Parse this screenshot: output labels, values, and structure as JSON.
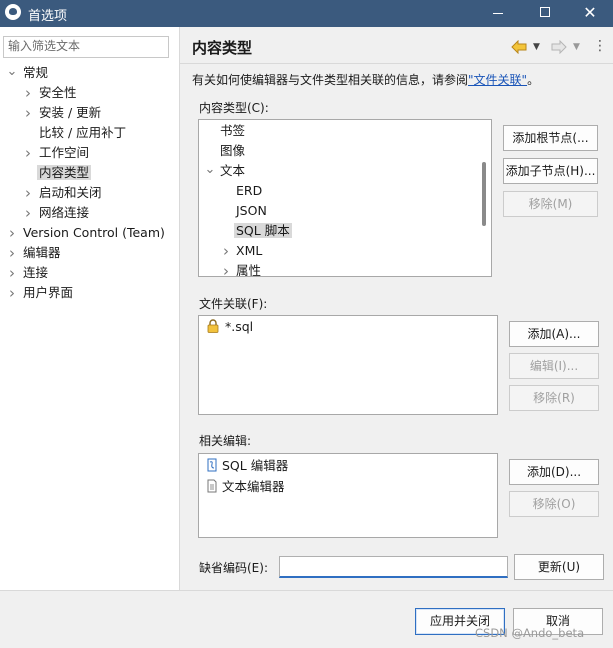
{
  "window": {
    "title": "首选项",
    "min_glyph": "—",
    "close_glyph": "✕"
  },
  "left_tree": {
    "filter_placeholder": "输入筛选文本",
    "items": [
      {
        "label": "常规"
      },
      {
        "label": "安全性"
      },
      {
        "label": "安装 / 更新"
      },
      {
        "label": "比较 / 应用补丁"
      },
      {
        "label": "工作空间"
      },
      {
        "label": "内容类型"
      },
      {
        "label": "启动和关闭"
      },
      {
        "label": "网络连接"
      },
      {
        "label": "Version Control (Team)"
      },
      {
        "label": "编辑器"
      },
      {
        "label": "连接"
      },
      {
        "label": "用户界面"
      }
    ]
  },
  "page": {
    "title": "内容类型",
    "description": "有关如何使编辑器与文件类型相关联的信息，请参阅",
    "link": "\"文件关联\"",
    "desc_end": "。"
  },
  "content_types": {
    "label": "内容类型(C):",
    "items": [
      {
        "label": "书签"
      },
      {
        "label": "图像"
      },
      {
        "label": "文本"
      },
      {
        "label": "ERD"
      },
      {
        "label": "JSON"
      },
      {
        "label": "SQL 脚本"
      },
      {
        "label": "XML"
      },
      {
        "label": "属性"
      }
    ],
    "buttons": {
      "add_root": "添加根节点(...",
      "add_child": "添加子节点(H)...",
      "remove": "移除(M)"
    }
  },
  "file_assoc": {
    "label": "文件关联(F):",
    "items": [
      {
        "label": "*.sql"
      }
    ],
    "buttons": {
      "add": "添加(A)...",
      "edit": "编辑(I)...",
      "remove": "移除(R)"
    }
  },
  "editors": {
    "label": "相关编辑:",
    "items": [
      {
        "label": "SQL 编辑器"
      },
      {
        "label": "文本编辑器"
      }
    ],
    "buttons": {
      "add": "添加(D)...",
      "remove": "移除(O)"
    }
  },
  "encoding": {
    "label": "缺省编码(E):",
    "value": "",
    "update_button": "更新(U)"
  },
  "footer": {
    "apply_close": "应用并关闭",
    "cancel": "取消",
    "watermark": "CSDN @Ando_beta"
  },
  "colors": {
    "titlebar": "#3b5a7e",
    "link": "#1a55b8",
    "focus": "#2f6fc2",
    "selection": "#d9d9d9"
  },
  "icons": [
    "back-arrow-icon",
    "forward-arrow-icon",
    "lock-icon",
    "sql-editor-icon",
    "text-file-icon"
  ]
}
